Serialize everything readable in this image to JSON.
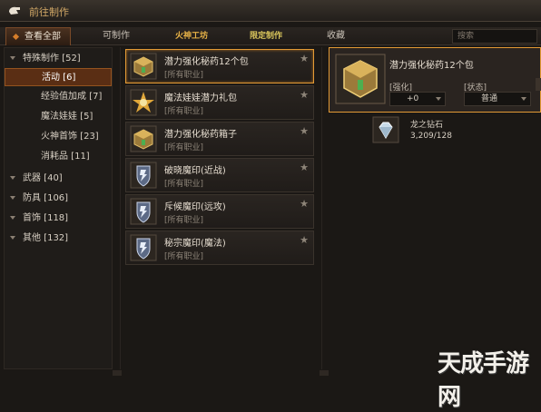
{
  "window": {
    "title": "前往制作"
  },
  "tabs": [
    {
      "label": "查看全部"
    },
    {
      "label": "可制作"
    },
    {
      "label": "火神工坊"
    },
    {
      "label": "限定制作"
    },
    {
      "label": "收藏"
    }
  ],
  "search": {
    "placeholder": "搜索"
  },
  "tree": [
    {
      "label": "特殊制作 [52]"
    },
    {
      "label": "活动 [6]"
    },
    {
      "label": "经验值加成 [7]"
    },
    {
      "label": "魔法娃娃 [5]"
    },
    {
      "label": "火神首饰 [23]"
    },
    {
      "label": "消耗品 [11]"
    },
    {
      "label": "武器 [40]"
    },
    {
      "label": "防具 [106]"
    },
    {
      "label": "首饰 [118]"
    },
    {
      "label": "其他 [132]"
    }
  ],
  "items": [
    {
      "name": "潜力强化秘药12个包",
      "tag": "[所有职业]",
      "icon": "gold-crate-icon"
    },
    {
      "name": "魔法娃娃潜力礼包",
      "tag": "[所有职业]",
      "icon": "star-burst-icon"
    },
    {
      "name": "潜力强化秘药箱子",
      "tag": "[所有职业]",
      "icon": "gold-crate-icon"
    },
    {
      "name": "破晓魔印(近战)",
      "tag": "[所有职业]",
      "icon": "shield-rune-icon"
    },
    {
      "name": "斥候魔印(远攻)",
      "tag": "[所有职业]",
      "icon": "shield-rune-icon"
    },
    {
      "name": "秘宗魔印(魔法)",
      "tag": "[所有职业]",
      "icon": "shield-rune-icon"
    }
  ],
  "detail": {
    "name": "潜力强化秘药12个包",
    "enhance_label": "[强化]",
    "enhance_value": "+0",
    "state_label": "[状态]",
    "state_value": "普通"
  },
  "material": {
    "name": "龙之钻石",
    "qty": "3,209/128",
    "icon": "diamond-icon"
  },
  "watermark": "天成手游网",
  "colors": {
    "accent": "#e39a35",
    "selected_bg": "#5a2e14"
  }
}
